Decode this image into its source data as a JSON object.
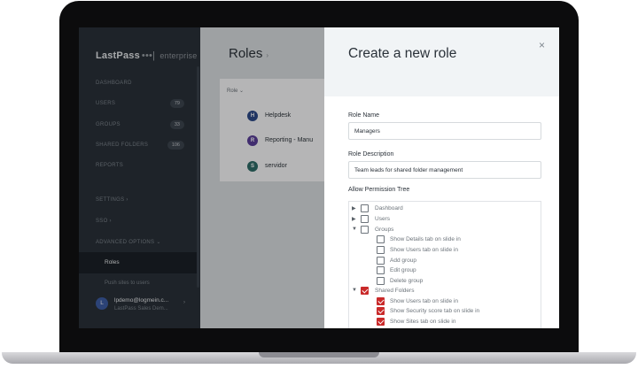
{
  "sidebar": {
    "brand": "LastPass",
    "brand_dots": "•••|",
    "brand_edition": "enterprise",
    "nav": [
      {
        "label": "DASHBOARD",
        "badge": ""
      },
      {
        "label": "USERS",
        "badge": "79"
      },
      {
        "label": "GROUPS",
        "badge": "33"
      },
      {
        "label": "SHARED FOLDERS",
        "badge": "106"
      },
      {
        "label": "REPORTS",
        "badge": ""
      },
      {
        "label": "SETTINGS",
        "chevron": "›"
      },
      {
        "label": "SSO",
        "chevron": "›"
      },
      {
        "label": "ADVANCED OPTIONS",
        "chevron": "⌄"
      }
    ],
    "active_item": "Roles",
    "sub_item": "Push sites to users",
    "user": {
      "initial": "L",
      "email": "lpdemo@logmein.c...",
      "org": "LastPass Sales Dem..."
    }
  },
  "main": {
    "title": "Roles",
    "title_chevron": "›",
    "table_header": "Role ⌄",
    "rows": [
      {
        "initial": "H",
        "label": "Helpdesk",
        "color": "#2d4a8a"
      },
      {
        "initial": "R",
        "label": "Reporting - Manu",
        "color": "#5a3f9a"
      },
      {
        "initial": "S",
        "label": "servidor",
        "color": "#2f6d68"
      }
    ]
  },
  "panel": {
    "title": "Create a new role",
    "close_icon": "×",
    "role_name_label": "Role Name",
    "role_name_value": "Managers",
    "role_desc_label": "Role Description",
    "role_desc_value": "Team leads for shared folder management",
    "tree_label": "Allow Permission Tree",
    "tree": [
      {
        "label": "Dashboard",
        "level": 0,
        "toggle": "▶",
        "checked": false
      },
      {
        "label": "Users",
        "level": 0,
        "toggle": "▶",
        "checked": false
      },
      {
        "label": "Groups",
        "level": 0,
        "toggle": "▼",
        "checked": false
      },
      {
        "label": "Show Details tab on slide in",
        "level": 1,
        "toggle": "",
        "checked": false
      },
      {
        "label": "Show Users tab on slide in",
        "level": 1,
        "toggle": "",
        "checked": false
      },
      {
        "label": "Add group",
        "level": 1,
        "toggle": "",
        "checked": false
      },
      {
        "label": "Edit group",
        "level": 1,
        "toggle": "",
        "checked": false
      },
      {
        "label": "Delete group",
        "level": 1,
        "toggle": "",
        "checked": false
      },
      {
        "label": "Shared Folders",
        "level": 0,
        "toggle": "▼",
        "checked": true
      },
      {
        "label": "Show Users tab on slide in",
        "level": 1,
        "toggle": "",
        "checked": true
      },
      {
        "label": "Show Security score tab on slide in",
        "level": 1,
        "toggle": "",
        "checked": true
      },
      {
        "label": "Show Sites tab on slide in",
        "level": 1,
        "toggle": "",
        "checked": true
      }
    ]
  },
  "colors": {
    "accent_red": "#c92a2a",
    "sidebar_bg": "#2a3139"
  }
}
